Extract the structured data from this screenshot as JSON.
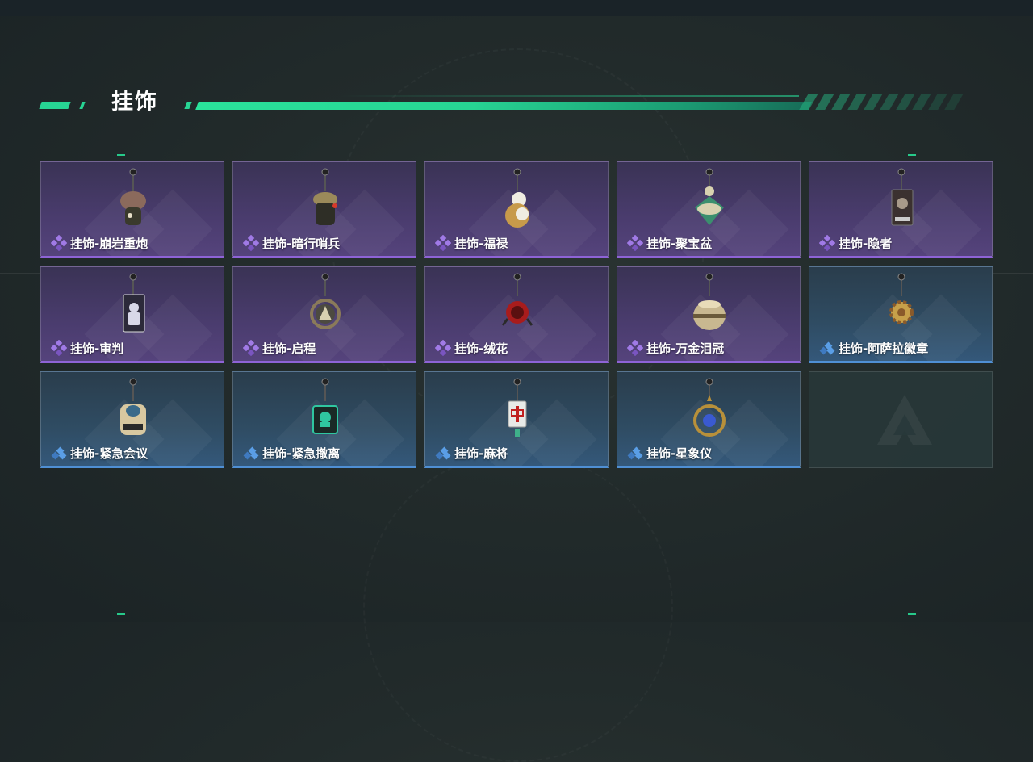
{
  "section": {
    "title": "挂饰"
  },
  "items": [
    {
      "name": "挂饰-崩岩重炮",
      "rarity": "purple",
      "icon": "mushroom-soldier-charm-icon",
      "colors": [
        "#8b6a5c",
        "#3a3a2c"
      ]
    },
    {
      "name": "挂饰-暗行哨兵",
      "rarity": "purple",
      "icon": "camo-sentinel-charm-icon",
      "colors": [
        "#9b8a5a",
        "#2e2e26"
      ]
    },
    {
      "name": "挂饰-福禄",
      "rarity": "purple",
      "icon": "gourd-charm-icon",
      "colors": [
        "#c79a4a",
        "#f0ede2"
      ]
    },
    {
      "name": "挂饰-聚宝盆",
      "rarity": "purple",
      "icon": "treasure-bowl-charm-icon",
      "colors": [
        "#d8d2b0",
        "#3b8f6e"
      ]
    },
    {
      "name": "挂饰-隐者",
      "rarity": "purple",
      "icon": "hermit-card-charm-icon",
      "colors": [
        "#3b3130",
        "#a89a8a"
      ]
    },
    {
      "name": "挂饰-审判",
      "rarity": "purple",
      "icon": "judgment-card-charm-icon",
      "colors": [
        "#2c2a3a",
        "#d8d8e8"
      ]
    },
    {
      "name": "挂饰-启程",
      "rarity": "purple",
      "icon": "departure-medal-charm-icon",
      "colors": [
        "#4c4a40",
        "#8a7a5a"
      ]
    },
    {
      "name": "挂饰-绒花",
      "rarity": "purple",
      "icon": "velvet-flower-charm-icon",
      "colors": [
        "#a81c1c",
        "#5a1010"
      ]
    },
    {
      "name": "挂饰-万金泪冠",
      "rarity": "purple",
      "icon": "crown-orb-charm-icon",
      "colors": [
        "#c8b890",
        "#6a5a3a"
      ]
    },
    {
      "name": "挂饰-阿萨拉徽章",
      "rarity": "blue",
      "icon": "asala-badge-charm-icon",
      "colors": [
        "#8a5a2a",
        "#c7a04a"
      ]
    },
    {
      "name": "挂饰-紧急会议",
      "rarity": "blue",
      "icon": "emergency-meeting-charm-icon",
      "colors": [
        "#d8c8a0",
        "#3a6a8a"
      ]
    },
    {
      "name": "挂饰-紧急撤离",
      "rarity": "blue",
      "icon": "emergency-evac-charm-icon",
      "colors": [
        "#1a2a26",
        "#2fc7a0"
      ]
    },
    {
      "name": "挂饰-麻将",
      "rarity": "blue",
      "icon": "mahjong-tile-charm-icon",
      "colors": [
        "#e8eae8",
        "#c02020"
      ]
    },
    {
      "name": "挂饰-星象仪",
      "rarity": "blue",
      "icon": "astrolabe-charm-icon",
      "colors": [
        "#b8903a",
        "#3a5ad0"
      ]
    }
  ],
  "empty_slots": 1,
  "theme": {
    "accent": "#27d493",
    "purple_rarity": "#8e63d6",
    "blue_rarity": "#4f8fd4"
  }
}
